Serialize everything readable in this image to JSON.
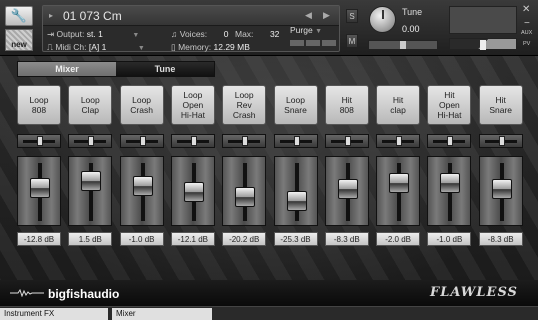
{
  "header": {
    "instrument_name": "01 073 Cm",
    "output_label": "Output:",
    "output_value": "st. 1",
    "voices_label": "Voices:",
    "voices_value": "0",
    "max_label": "Max:",
    "max_value": "32",
    "purge_label": "Purge",
    "midi_label": "Midi Ch:",
    "midi_value": "[A]  1",
    "memory_label": "Memory:",
    "memory_value": "12.29 MB",
    "new_label": "new",
    "solo_label": "S",
    "mute_label": "M",
    "tune_label": "Tune",
    "tune_value": "0.00",
    "aux_label": "AUX",
    "pv_label": "PV"
  },
  "tabs": [
    {
      "label": "Mixer",
      "active": true
    },
    {
      "label": "Tune",
      "active": false
    }
  ],
  "channels": [
    {
      "label": "Loop\n808",
      "db": "-12.8 dB",
      "level": 0.62
    },
    {
      "label": "Loop\nClap",
      "db": "1.5 dB",
      "level": 0.79
    },
    {
      "label": "Loop\nCrash",
      "db": "-1.0 dB",
      "level": 0.68
    },
    {
      "label": "Loop\nOpen\nHi-Hat",
      "db": "-12.1 dB",
      "level": 0.55
    },
    {
      "label": "Loop\nRev\nCrash",
      "db": "-20.2 dB",
      "level": 0.44
    },
    {
      "label": "Loop\nSnare",
      "db": "-25.3 dB",
      "level": 0.35
    },
    {
      "label": "Hit\n808",
      "db": "-8.3 dB",
      "level": 0.6
    },
    {
      "label": "Hit\nclap",
      "db": "-2.0 dB",
      "level": 0.75
    },
    {
      "label": "Hit\nOpen\nHi-Hat",
      "db": "-1.0 dB",
      "level": 0.74
    },
    {
      "label": "Hit\nSnare",
      "db": "-8.3 dB",
      "level": 0.61
    }
  ],
  "footer": {
    "brand": "bigfishaudio",
    "product": "FLAWLESS"
  },
  "status": {
    "instrument_fx": "Instrument FX",
    "mixer": "Mixer"
  },
  "colors": {
    "pad_light": "#e6e6e6",
    "pad_dark": "#b8b8b8",
    "background": "#1a1a1a"
  }
}
